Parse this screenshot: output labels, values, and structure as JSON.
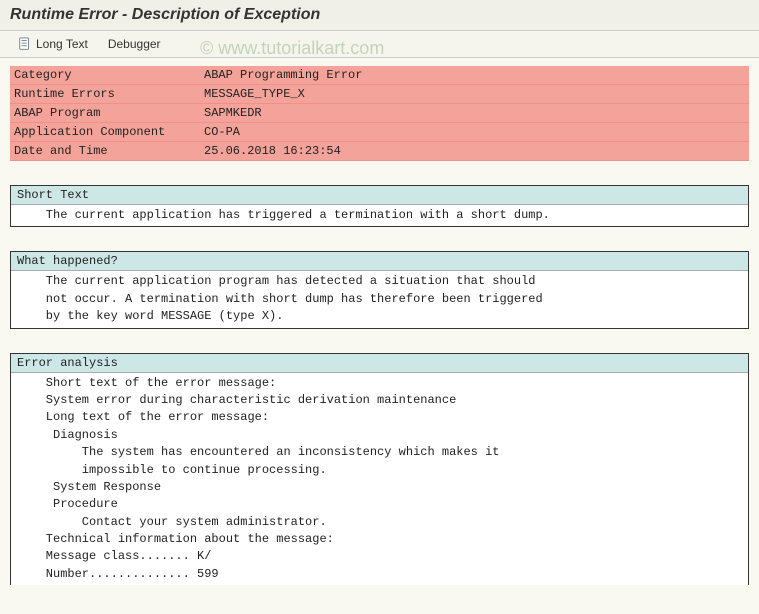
{
  "title": "Runtime Error - Description of Exception",
  "watermark": "© www.tutorialkart.com",
  "toolbar": {
    "long_text_label": "Long Text",
    "debugger_label": "Debugger"
  },
  "meta": [
    {
      "label": "Category",
      "value": "ABAP Programming Error"
    },
    {
      "label": "Runtime Errors",
      "value": "MESSAGE_TYPE_X"
    },
    {
      "label": "ABAP Program",
      "value": "SAPMKEDR"
    },
    {
      "label": "Application Component",
      "value": "CO-PA"
    },
    {
      "label": "Date and Time",
      "value": "25.06.2018 16:23:54"
    }
  ],
  "sections": {
    "short_text": {
      "title": "Short Text",
      "body": "    The current application has triggered a termination with a short dump."
    },
    "what_happened": {
      "title": "What happened?",
      "body": "    The current application program has detected a situation that should\n    not occur. A termination with short dump has therefore been triggered\n    by the key word MESSAGE (type X)."
    },
    "error_analysis": {
      "title": "Error analysis",
      "body": "    Short text of the error message:\n    System error during characteristic derivation maintenance\n    Long text of the error message:\n     Diagnosis\n         The system has encountered an inconsistency which makes it\n         impossible to continue processing.\n     System Response\n     Procedure\n         Contact your system administrator.\n    Technical information about the message:\n    Message class....... K/\n    Number.............. 599"
    }
  }
}
